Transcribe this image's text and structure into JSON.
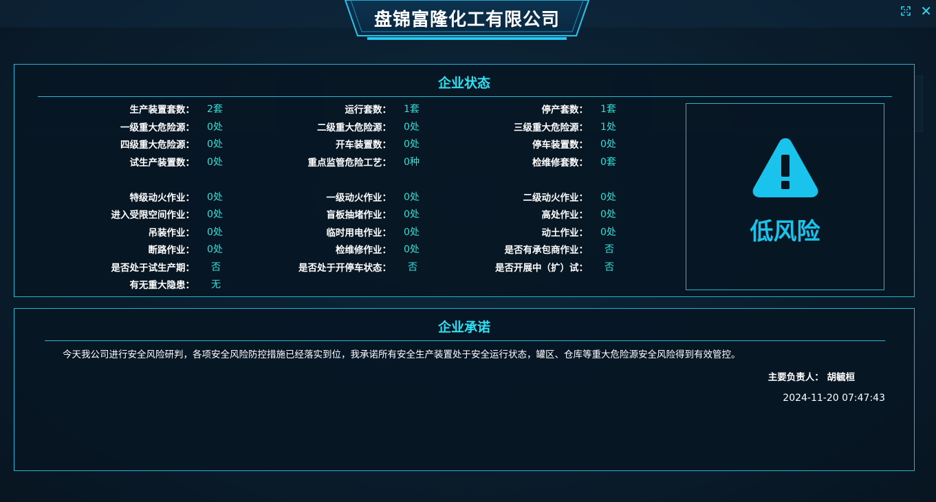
{
  "window": {
    "title": "盘锦富隆化工有限公司"
  },
  "colors": {
    "accent": "#2fe0f2",
    "value": "#2fe0d8",
    "risk_low": "#19c3ec",
    "border": "#26b6d4",
    "background": "#0a1d2d"
  },
  "icons": {
    "fullscreen": "fullscreen-icon",
    "close": "close-icon",
    "warning": "warning-triangle-icon"
  },
  "status": {
    "title": "企业状态",
    "columns": [
      [
        {
          "label": "生产装置套数：",
          "value": "2套"
        },
        {
          "label": "一级重大危险源：",
          "value": "0处"
        },
        {
          "label": "四级重大危险源：",
          "value": "0处"
        },
        {
          "label": "试生产装置数：",
          "value": "0处"
        },
        {
          "label": "特级动火作业：",
          "value": "0处"
        },
        {
          "label": "进入受限空间作业：",
          "value": "0处"
        },
        {
          "label": "吊装作业：",
          "value": "0处"
        },
        {
          "label": "断路作业：",
          "value": "0处"
        },
        {
          "label": "是否处于试生产期：",
          "value": "否"
        },
        {
          "label": "有无重大隐患：",
          "value": "无"
        }
      ],
      [
        {
          "label": "运行套数：",
          "value": "1套"
        },
        {
          "label": "二级重大危险源：",
          "value": "0处"
        },
        {
          "label": "开车装置数：",
          "value": "0处"
        },
        {
          "label": "重点监管危险工艺：",
          "value": "0种"
        },
        {
          "label": "一级动火作业：",
          "value": "0处"
        },
        {
          "label": "盲板抽堵作业：",
          "value": "0处"
        },
        {
          "label": "临时用电作业：",
          "value": "0处"
        },
        {
          "label": "检维修作业：",
          "value": "0处"
        },
        {
          "label": "是否处于开停车状态：",
          "value": "否"
        }
      ],
      [
        {
          "label": "停产套数：",
          "value": "1套"
        },
        {
          "label": "三级重大危险源：",
          "value": "1处"
        },
        {
          "label": "停车装置数：",
          "value": "0处"
        },
        {
          "label": "检维修套数：",
          "value": "0套"
        },
        {
          "label": "二级动火作业：",
          "value": "0处"
        },
        {
          "label": "高处作业：",
          "value": "0处"
        },
        {
          "label": "动土作业：",
          "value": "0处"
        },
        {
          "label": "是否有承包商作业：",
          "value": "否"
        },
        {
          "label": "是否开展中（扩）试：",
          "value": "否"
        }
      ]
    ],
    "risk_level": "低风险"
  },
  "promise": {
    "title": "企业承诺",
    "text": "今天我公司进行安全风险研判，各项安全风险防控措施已经落实到位，我承诺所有安全生产装置处于安全运行状态，罐区、仓库等重大危险源安全风险得到有效管控。",
    "owner_label": "主要负责人：",
    "owner_name": "胡毓桓",
    "date": "2024-11-20 07:47:43"
  }
}
